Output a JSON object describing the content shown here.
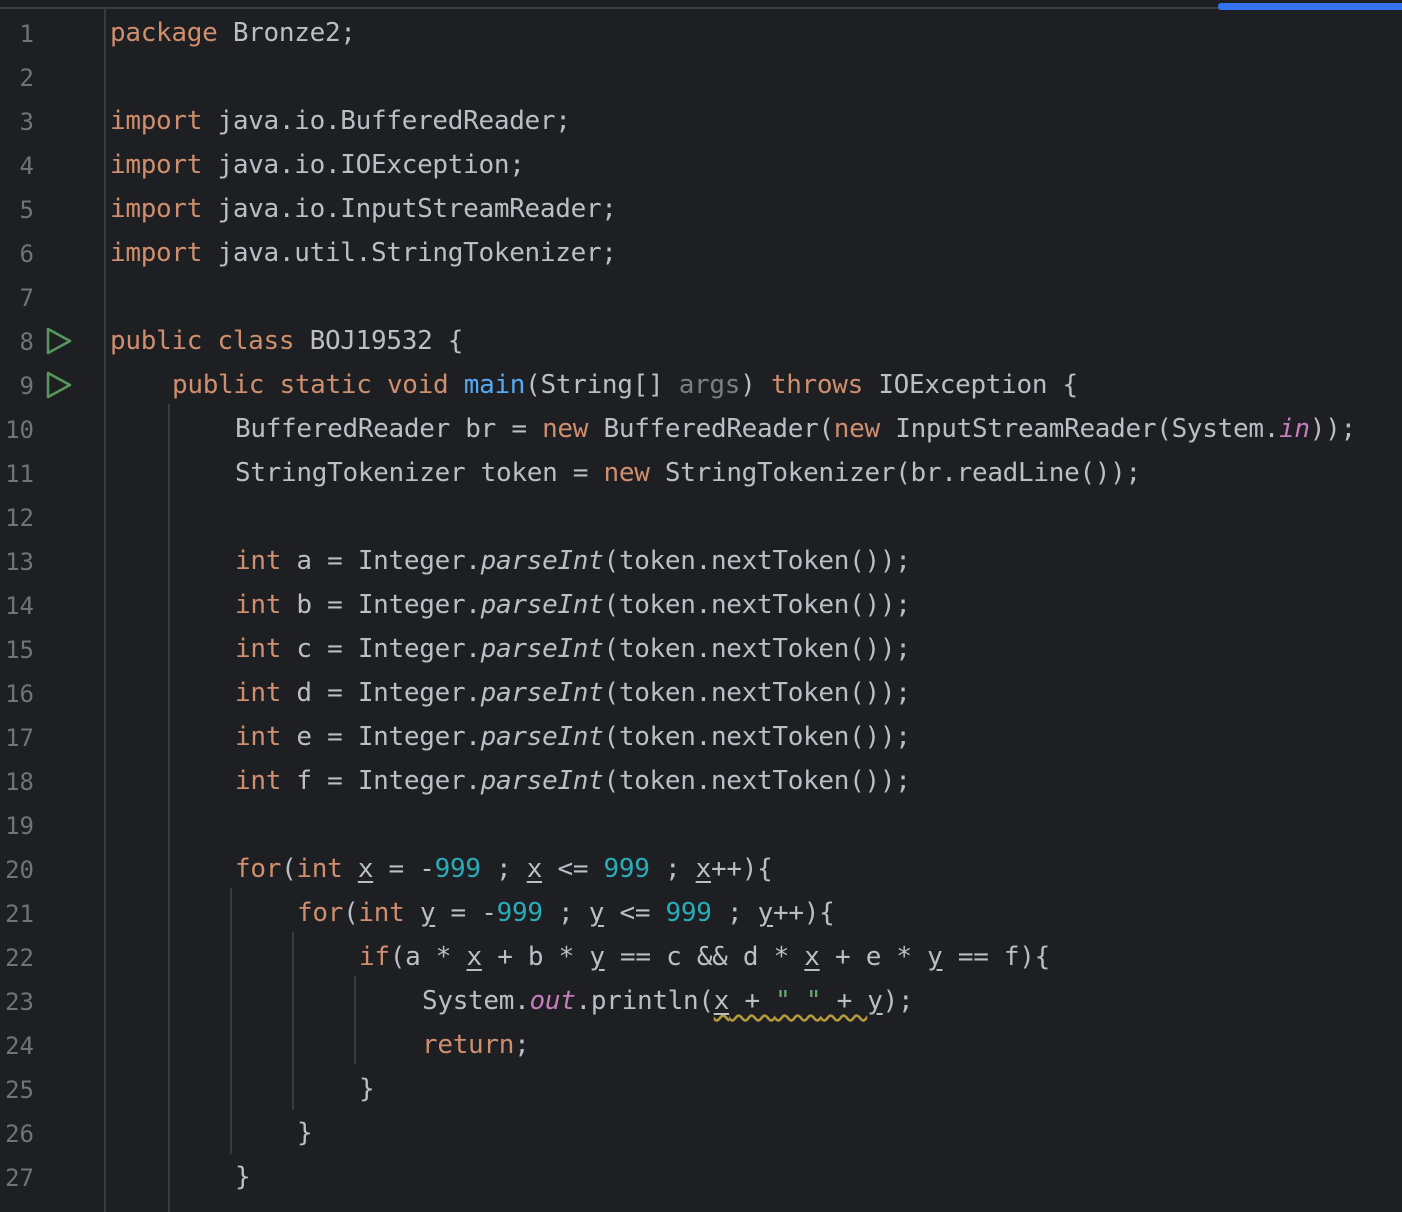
{
  "editor": {
    "language": "java",
    "lines": [
      {
        "n": "1"
      },
      {
        "n": "2"
      },
      {
        "n": "3"
      },
      {
        "n": "4"
      },
      {
        "n": "5"
      },
      {
        "n": "6"
      },
      {
        "n": "7"
      },
      {
        "n": "8",
        "run": true
      },
      {
        "n": "9",
        "run": true
      },
      {
        "n": "10"
      },
      {
        "n": "11"
      },
      {
        "n": "12"
      },
      {
        "n": "13"
      },
      {
        "n": "14"
      },
      {
        "n": "15"
      },
      {
        "n": "16"
      },
      {
        "n": "17"
      },
      {
        "n": "18"
      },
      {
        "n": "19"
      },
      {
        "n": "20"
      },
      {
        "n": "21"
      },
      {
        "n": "22"
      },
      {
        "n": "23"
      },
      {
        "n": "24"
      },
      {
        "n": "25"
      },
      {
        "n": "26"
      },
      {
        "n": "27"
      }
    ],
    "code": {
      "l1_kw": "package",
      "l1_rest": " Bronze2;",
      "import_kw": "import",
      "l3_rest": " java.io.BufferedReader;",
      "l4_rest": " java.io.IOException;",
      "l5_rest": " java.io.InputStreamReader;",
      "l6_rest": " java.util.StringTokenizer;",
      "l8_kw": "public class",
      "l8_rest": " BOJ19532 {",
      "l9_kw1": "public static void",
      "l9_fn": "main",
      "l9_a": "(String[] ",
      "l9_param": "args",
      "l9_b": ") ",
      "l9_kw2": "throws",
      "l9_c": " IOException {",
      "l10_a": "BufferedReader br = ",
      "new_kw": "new",
      "l10_b": " BufferedReader(",
      "l10_c": " InputStreamReader(System.",
      "l10_field": "in",
      "l10_d": "));",
      "l11_a": "StringTokenizer token = ",
      "l11_b": " StringTokenizer(br.readLine());",
      "int_kw": "int",
      "l13_var": " a = Integer.",
      "l14_var": " b = Integer.",
      "l15_var": " c = Integer.",
      "l16_var": " d = Integer.",
      "l17_var": " e = Integer.",
      "l18_var": " f = Integer.",
      "parse_fn": "parseInt",
      "parse_rest": "(token.nextToken());",
      "for_kw": "for",
      "paren_open": "(",
      "x": "x",
      "y": "y",
      "eq_neg": " = -",
      "n999": "999",
      "semi_sp": " ; ",
      "le": " <= ",
      "plusplus_brace": "++){",
      "if_kw": "if",
      "l22_a": "(a * ",
      "l22_b": " + b * ",
      "l22_c": " == c && d * ",
      "l22_d": " + e * ",
      "l22_e": " == f){",
      "l23_a": "System.",
      "l23_field": "out",
      "l23_b": ".println(",
      "l23_plus": " + ",
      "l23_str": "\" \"",
      "l23_c": ");",
      "return_kw": "return",
      "semicolon": ";",
      "close_brace": "}"
    }
  }
}
